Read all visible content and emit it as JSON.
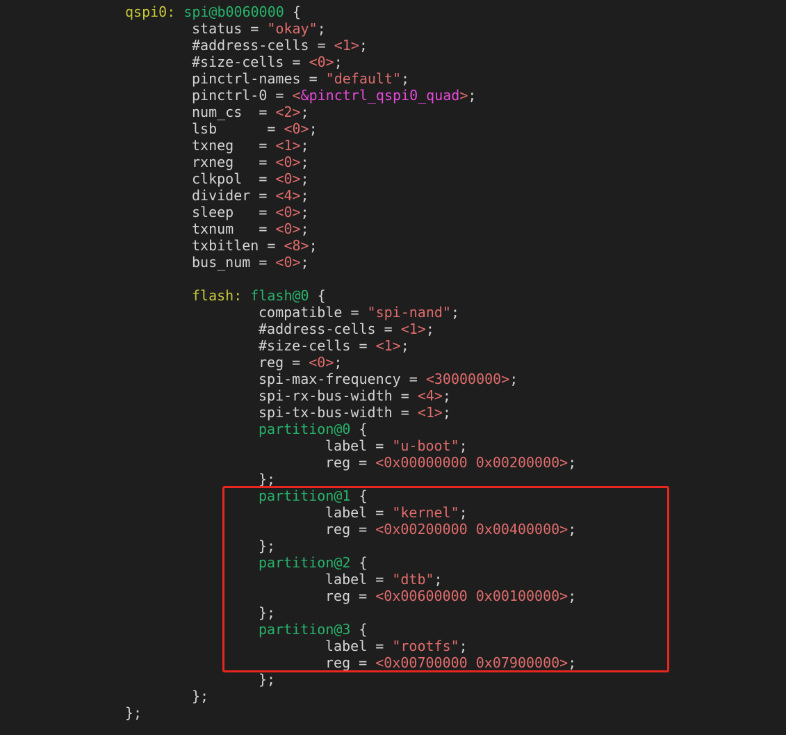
{
  "colors": {
    "background": "#1e1e1e",
    "plain": "#d4d4d4",
    "label": "#c8c83a",
    "node": "#27b26a",
    "string": "#e06c6c",
    "reference": "#e64ad9",
    "highlight_box": "#e8261f"
  },
  "code": {
    "lines": [
      {
        "indent": 180,
        "tokens": [
          {
            "t": "label",
            "v": "qspi0:"
          },
          {
            "t": "plain",
            "v": " "
          },
          {
            "t": "node",
            "v": "spi@b0060000"
          },
          {
            "t": "plain",
            "v": " {"
          }
        ]
      },
      {
        "indent": 276,
        "tokens": [
          {
            "t": "plain",
            "v": "status = "
          },
          {
            "t": "string",
            "v": "\"okay\""
          },
          {
            "t": "plain",
            "v": ";"
          }
        ]
      },
      {
        "indent": 276,
        "tokens": [
          {
            "t": "plain",
            "v": "#address-cells = "
          },
          {
            "t": "value",
            "v": "<1>"
          },
          {
            "t": "plain",
            "v": ";"
          }
        ]
      },
      {
        "indent": 276,
        "tokens": [
          {
            "t": "plain",
            "v": "#size-cells = "
          },
          {
            "t": "value",
            "v": "<0>"
          },
          {
            "t": "plain",
            "v": ";"
          }
        ]
      },
      {
        "indent": 276,
        "tokens": [
          {
            "t": "plain",
            "v": "pinctrl-names = "
          },
          {
            "t": "string",
            "v": "\"default\""
          },
          {
            "t": "plain",
            "v": ";"
          }
        ]
      },
      {
        "indent": 276,
        "tokens": [
          {
            "t": "plain",
            "v": "pinctrl-0 = "
          },
          {
            "t": "value",
            "v": "<"
          },
          {
            "t": "ref",
            "v": "&pinctrl_qspi0_quad"
          },
          {
            "t": "value",
            "v": ">"
          },
          {
            "t": "plain",
            "v": ";"
          }
        ]
      },
      {
        "indent": 276,
        "tokens": [
          {
            "t": "plain",
            "v": "num_cs  = "
          },
          {
            "t": "value",
            "v": "<2>"
          },
          {
            "t": "plain",
            "v": ";"
          }
        ]
      },
      {
        "indent": 276,
        "tokens": [
          {
            "t": "plain",
            "v": "lsb      = "
          },
          {
            "t": "value",
            "v": "<0>"
          },
          {
            "t": "plain",
            "v": ";"
          }
        ]
      },
      {
        "indent": 276,
        "tokens": [
          {
            "t": "plain",
            "v": "txneg   = "
          },
          {
            "t": "value",
            "v": "<1>"
          },
          {
            "t": "plain",
            "v": ";"
          }
        ]
      },
      {
        "indent": 276,
        "tokens": [
          {
            "t": "plain",
            "v": "rxneg   = "
          },
          {
            "t": "value",
            "v": "<0>"
          },
          {
            "t": "plain",
            "v": ";"
          }
        ]
      },
      {
        "indent": 276,
        "tokens": [
          {
            "t": "plain",
            "v": "clkpol  = "
          },
          {
            "t": "value",
            "v": "<0>"
          },
          {
            "t": "plain",
            "v": ";"
          }
        ]
      },
      {
        "indent": 276,
        "tokens": [
          {
            "t": "plain",
            "v": "divider = "
          },
          {
            "t": "value",
            "v": "<4>"
          },
          {
            "t": "plain",
            "v": ";"
          }
        ]
      },
      {
        "indent": 276,
        "tokens": [
          {
            "t": "plain",
            "v": "sleep   = "
          },
          {
            "t": "value",
            "v": "<0>"
          },
          {
            "t": "plain",
            "v": ";"
          }
        ]
      },
      {
        "indent": 276,
        "tokens": [
          {
            "t": "plain",
            "v": "txnum   = "
          },
          {
            "t": "value",
            "v": "<0>"
          },
          {
            "t": "plain",
            "v": ";"
          }
        ]
      },
      {
        "indent": 276,
        "tokens": [
          {
            "t": "plain",
            "v": "txbitlen = "
          },
          {
            "t": "value",
            "v": "<8>"
          },
          {
            "t": "plain",
            "v": ";"
          }
        ]
      },
      {
        "indent": 276,
        "tokens": [
          {
            "t": "plain",
            "v": "bus_num = "
          },
          {
            "t": "value",
            "v": "<0>"
          },
          {
            "t": "plain",
            "v": ";"
          }
        ]
      },
      {
        "indent": 276,
        "tokens": []
      },
      {
        "indent": 276,
        "tokens": [
          {
            "t": "label",
            "v": "flash:"
          },
          {
            "t": "plain",
            "v": " "
          },
          {
            "t": "node",
            "v": "flash@0"
          },
          {
            "t": "plain",
            "v": " {"
          }
        ]
      },
      {
        "indent": 372,
        "tokens": [
          {
            "t": "plain",
            "v": "compatible = "
          },
          {
            "t": "string",
            "v": "\"spi-nand\""
          },
          {
            "t": "plain",
            "v": ";"
          }
        ]
      },
      {
        "indent": 372,
        "tokens": [
          {
            "t": "plain",
            "v": "#address-cells = "
          },
          {
            "t": "value",
            "v": "<1>"
          },
          {
            "t": "plain",
            "v": ";"
          }
        ]
      },
      {
        "indent": 372,
        "tokens": [
          {
            "t": "plain",
            "v": "#size-cells = "
          },
          {
            "t": "value",
            "v": "<1>"
          },
          {
            "t": "plain",
            "v": ";"
          }
        ]
      },
      {
        "indent": 372,
        "tokens": [
          {
            "t": "plain",
            "v": "reg = "
          },
          {
            "t": "value",
            "v": "<0>"
          },
          {
            "t": "plain",
            "v": ";"
          }
        ]
      },
      {
        "indent": 372,
        "tokens": [
          {
            "t": "plain",
            "v": "spi-max-frequency = "
          },
          {
            "t": "value",
            "v": "<30000000>"
          },
          {
            "t": "plain",
            "v": ";"
          }
        ]
      },
      {
        "indent": 372,
        "tokens": [
          {
            "t": "plain",
            "v": "spi-rx-bus-width = "
          },
          {
            "t": "value",
            "v": "<4>"
          },
          {
            "t": "plain",
            "v": ";"
          }
        ]
      },
      {
        "indent": 372,
        "tokens": [
          {
            "t": "plain",
            "v": "spi-tx-bus-width = "
          },
          {
            "t": "value",
            "v": "<1>"
          },
          {
            "t": "plain",
            "v": ";"
          }
        ]
      },
      {
        "indent": 372,
        "tokens": [
          {
            "t": "node",
            "v": "partition@0"
          },
          {
            "t": "plain",
            "v": " {"
          }
        ]
      },
      {
        "indent": 468,
        "tokens": [
          {
            "t": "plain",
            "v": "label = "
          },
          {
            "t": "string",
            "v": "\"u-boot\""
          },
          {
            "t": "plain",
            "v": ";"
          }
        ]
      },
      {
        "indent": 468,
        "tokens": [
          {
            "t": "plain",
            "v": "reg = "
          },
          {
            "t": "value",
            "v": "<0x00000000 0x00200000>"
          },
          {
            "t": "plain",
            "v": ";"
          }
        ]
      },
      {
        "indent": 372,
        "tokens": [
          {
            "t": "plain",
            "v": "};"
          }
        ]
      },
      {
        "indent": 372,
        "tokens": [
          {
            "t": "node",
            "v": "partition@1"
          },
          {
            "t": "plain",
            "v": " {"
          }
        ]
      },
      {
        "indent": 468,
        "tokens": [
          {
            "t": "plain",
            "v": "label = "
          },
          {
            "t": "string",
            "v": "\"kernel\""
          },
          {
            "t": "plain",
            "v": ";"
          }
        ]
      },
      {
        "indent": 468,
        "tokens": [
          {
            "t": "plain",
            "v": "reg = "
          },
          {
            "t": "value",
            "v": "<0x00200000 0x00400000>"
          },
          {
            "t": "plain",
            "v": ";"
          }
        ]
      },
      {
        "indent": 372,
        "tokens": [
          {
            "t": "plain",
            "v": "};"
          }
        ]
      },
      {
        "indent": 372,
        "tokens": [
          {
            "t": "node",
            "v": "partition@2"
          },
          {
            "t": "plain",
            "v": " {"
          }
        ]
      },
      {
        "indent": 468,
        "tokens": [
          {
            "t": "plain",
            "v": "label = "
          },
          {
            "t": "string",
            "v": "\"dtb\""
          },
          {
            "t": "plain",
            "v": ";"
          }
        ]
      },
      {
        "indent": 468,
        "tokens": [
          {
            "t": "plain",
            "v": "reg = "
          },
          {
            "t": "value",
            "v": "<0x00600000 0x00100000>"
          },
          {
            "t": "plain",
            "v": ";"
          }
        ]
      },
      {
        "indent": 372,
        "tokens": [
          {
            "t": "plain",
            "v": "};"
          }
        ]
      },
      {
        "indent": 372,
        "tokens": [
          {
            "t": "node",
            "v": "partition@3"
          },
          {
            "t": "plain",
            "v": " {"
          }
        ]
      },
      {
        "indent": 468,
        "tokens": [
          {
            "t": "plain",
            "v": "label = "
          },
          {
            "t": "string",
            "v": "\"rootfs\""
          },
          {
            "t": "plain",
            "v": ";"
          }
        ]
      },
      {
        "indent": 468,
        "tokens": [
          {
            "t": "plain",
            "v": "reg = "
          },
          {
            "t": "value",
            "v": "<0x00700000 0x07900000>"
          },
          {
            "t": "plain",
            "v": ";"
          }
        ]
      },
      {
        "indent": 372,
        "tokens": [
          {
            "t": "plain",
            "v": "};"
          }
        ]
      },
      {
        "indent": 276,
        "tokens": [
          {
            "t": "plain",
            "v": "};"
          }
        ]
      },
      {
        "indent": 180,
        "tokens": [
          {
            "t": "plain",
            "v": "};"
          }
        ]
      }
    ]
  }
}
